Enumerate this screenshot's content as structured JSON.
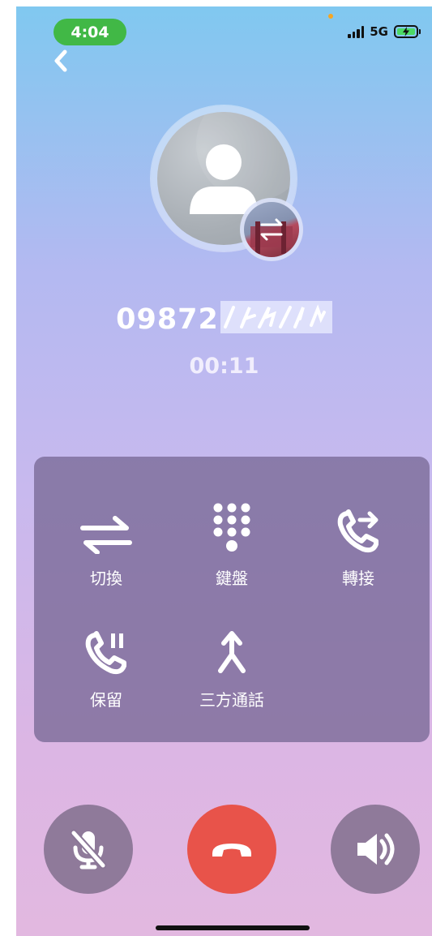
{
  "status_bar": {
    "time": "4:04",
    "network": "5G",
    "icons": [
      "signal-icon",
      "battery-charging-icon"
    ]
  },
  "nav": {
    "back_icon": "chevron-left-icon"
  },
  "call": {
    "number_visible": "09872",
    "timer": "00:11"
  },
  "controls": [
    {
      "label": "切換",
      "icon": "swap-arrows-icon"
    },
    {
      "label": "鍵盤",
      "icon": "keypad-icon"
    },
    {
      "label": "轉接",
      "icon": "call-transfer-icon"
    },
    {
      "label": "保留",
      "icon": "call-hold-icon"
    },
    {
      "label": "三方通話",
      "icon": "merge-call-icon"
    }
  ],
  "bottom_actions": {
    "mute_icon": "mic-off-icon",
    "end_call_icon": "hang-up-icon",
    "speaker_icon": "speaker-icon"
  },
  "colors": {
    "status_pill": "#41b846",
    "end_call": "#e8534a",
    "panel": "#786996"
  }
}
